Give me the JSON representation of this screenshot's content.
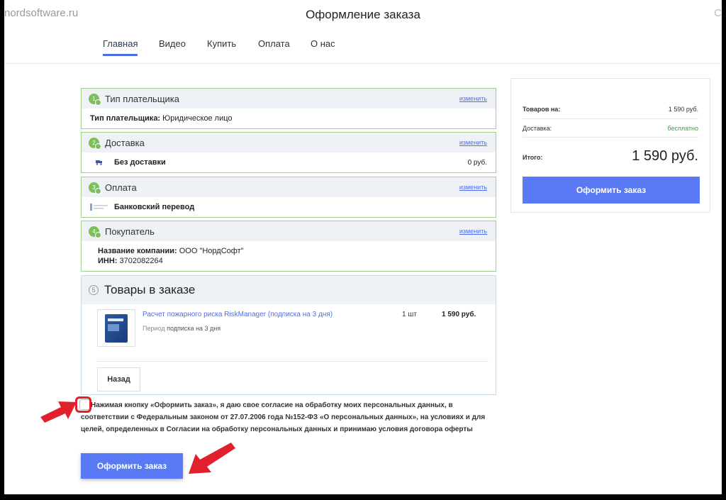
{
  "header": {
    "url_fragment": "nordsoftware.ru",
    "title": "Оформление заказа",
    "clipped_text": "С"
  },
  "nav": {
    "items": [
      {
        "label": "Главная",
        "active": true
      },
      {
        "label": "Видео"
      },
      {
        "label": "Купить"
      },
      {
        "label": "Оплата"
      },
      {
        "label": "О нас"
      }
    ]
  },
  "sections": {
    "payer": {
      "number": "1",
      "title": "Тип плательщика",
      "change": "изменить",
      "label": "Тип плательщика:",
      "value": "Юридическое лицо"
    },
    "delivery": {
      "number": "2",
      "title": "Доставка",
      "change": "изменить",
      "method": "Без доставки",
      "price": "0 руб."
    },
    "payment": {
      "number": "3",
      "title": "Оплата",
      "change": "изменить",
      "method": "Банковский перевод"
    },
    "buyer": {
      "number": "4",
      "title": "Покупатель",
      "change": "изменить",
      "company_label": "Название компании:",
      "company_value": "ООО \"НордСофт\"",
      "inn_label": "ИНН:",
      "inn_value": "3702082264"
    }
  },
  "goods": {
    "number": "5",
    "title": "Товары в заказе",
    "product": {
      "name": "Расчет пожарного риска RiskManager (подписка на 3 дня)",
      "period_label": "Период",
      "period_value": "подписка на 3 дня",
      "qty": "1 шт",
      "price": "1 590 руб."
    },
    "back_label": "Назад"
  },
  "consent": {
    "text": "Нажимая кнопку «Оформить заказ», я даю свое согласие на обработку моих персональных данных, в соответствии с Федеральным законом от 27.07.2006 года №152-ФЗ «О персональных данных», на условиях и для целей, определенных в Согласии на обработку персональных данных и принимаю условия договора оферты"
  },
  "order_button": "Оформить заказ",
  "summary": {
    "goods_label": "Товаров на:",
    "goods_value": "1 590 руб.",
    "delivery_label": "Доставка:",
    "delivery_value": "бесплатно",
    "total_label": "Итого:",
    "total_value": "1 590 руб.",
    "order_button": "Оформить заказ"
  },
  "colors": {
    "accent": "#5a7af5",
    "success_border": "#9ed28a",
    "annotation_red": "#e0202a"
  }
}
